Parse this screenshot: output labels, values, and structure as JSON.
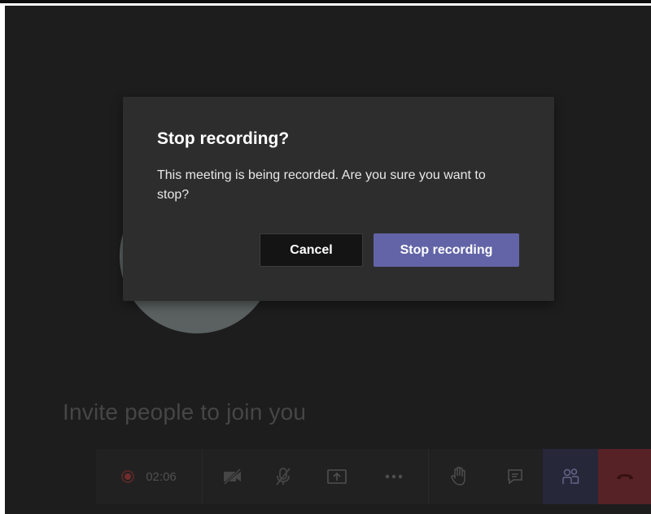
{
  "meeting": {
    "invite_text": "Invite people to join you",
    "recording_timer": "02:06"
  },
  "call_controls": {
    "items": [
      {
        "name": "recording-indicator",
        "icon": "record-icon"
      },
      {
        "name": "camera-toggle",
        "icon": "camera-off-icon"
      },
      {
        "name": "mic-toggle",
        "icon": "mic-off-icon"
      },
      {
        "name": "share-content",
        "icon": "share-screen-icon"
      },
      {
        "name": "more-actions",
        "icon": "more-icon"
      },
      {
        "name": "raise-hand",
        "icon": "hand-icon"
      },
      {
        "name": "show-conversation",
        "icon": "chat-icon"
      },
      {
        "name": "show-participants",
        "icon": "people-icon"
      },
      {
        "name": "hang-up",
        "icon": "phone-hangup-icon"
      }
    ],
    "colors": {
      "bar": "#232323",
      "participants_active": "#2a2a3e",
      "hangup": "#5c2427",
      "record_dot": "#7a2f2f"
    }
  },
  "dialog": {
    "title": "Stop recording?",
    "message": "This meeting is being recorded. Are you sure you want to stop?",
    "cancel_label": "Cancel",
    "confirm_label": "Stop recording",
    "colors": {
      "background": "#2d2d2d",
      "primary_button": "#6264a7",
      "secondary_button": "#141414"
    }
  }
}
